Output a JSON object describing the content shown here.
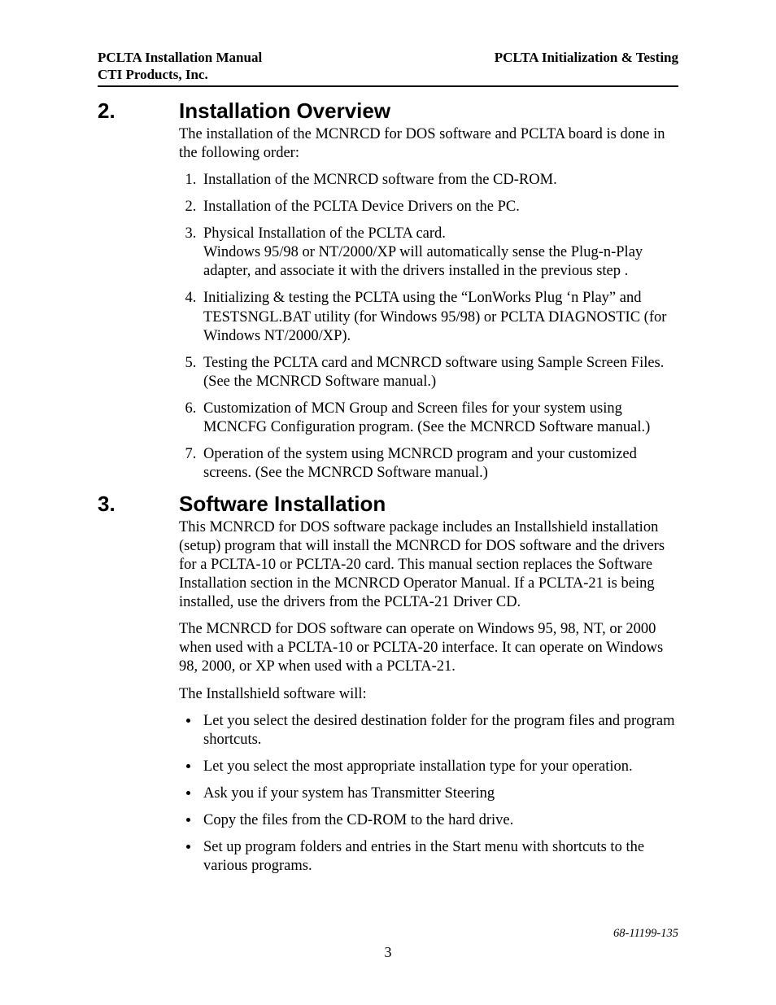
{
  "header": {
    "left_line1": "PCLTA Installation Manual",
    "left_line2": "CTI Products, Inc.",
    "right": "PCLTA Initialization & Testing"
  },
  "section2": {
    "number": "2.",
    "title": "Installation Overview",
    "intro": "The installation of the MCNRCD for DOS software and PCLTA board is done in the following order:",
    "items": [
      "Installation of the MCNRCD software from the CD-ROM.",
      "Installation of the PCLTA Device Drivers on the PC.",
      "Physical Installation of the PCLTA card.\nWindows 95/98 or NT/2000/XP will automatically sense the Plug-n-Play adapter, and associate it with the drivers installed in the previous step .",
      "Initializing & testing the PCLTA using the “LonWorks Plug ‘n Play” and TESTSNGL.BAT utility (for Windows 95/98) or PCLTA DIAGNOSTIC (for Windows NT/2000/XP).",
      "Testing the PCLTA card and MCNRCD software using Sample Screen Files. (See the MCNRCD Software manual.)",
      "Customization of MCN Group and Screen files for your system using MCNCFG Configuration program. (See the MCNRCD Software manual.)",
      "Operation of the system using MCNRCD program and your customized screens. (See the MCNRCD Software manual.)"
    ]
  },
  "section3": {
    "number": "3.",
    "title": "Software Installation",
    "para1": "This MCNRCD for DOS software package includes an Installshield installation (setup) program that will install the MCNRCD for DOS software and the drivers for a PCLTA-10 or PCLTA-20 card.  This manual section replaces the Software Installation section in the MCNRCD Operator Manual.  If a PCLTA-21 is being installed, use the drivers from the PCLTA-21 Driver CD.",
    "para2": "The MCNRCD for DOS software can operate on Windows 95, 98, NT, or 2000 when used with a PCLTA-10 or PCLTA-20 interface.  It can operate on Windows 98, 2000, or XP when used with a PCLTA-21.",
    "para3": "The Installshield software will:",
    "bullets": [
      "Let you select the desired destination folder for the program files and program shortcuts.",
      "Let you select the most appropriate installation type for your operation.",
      "Ask you if your system has Transmitter Steering",
      "Copy the files from the CD-ROM to the hard drive.",
      "Set up program folders and entries in the Start menu with shortcuts to the various programs."
    ]
  },
  "footer": {
    "doc_id": "68-11199-135",
    "page_num": "3"
  }
}
